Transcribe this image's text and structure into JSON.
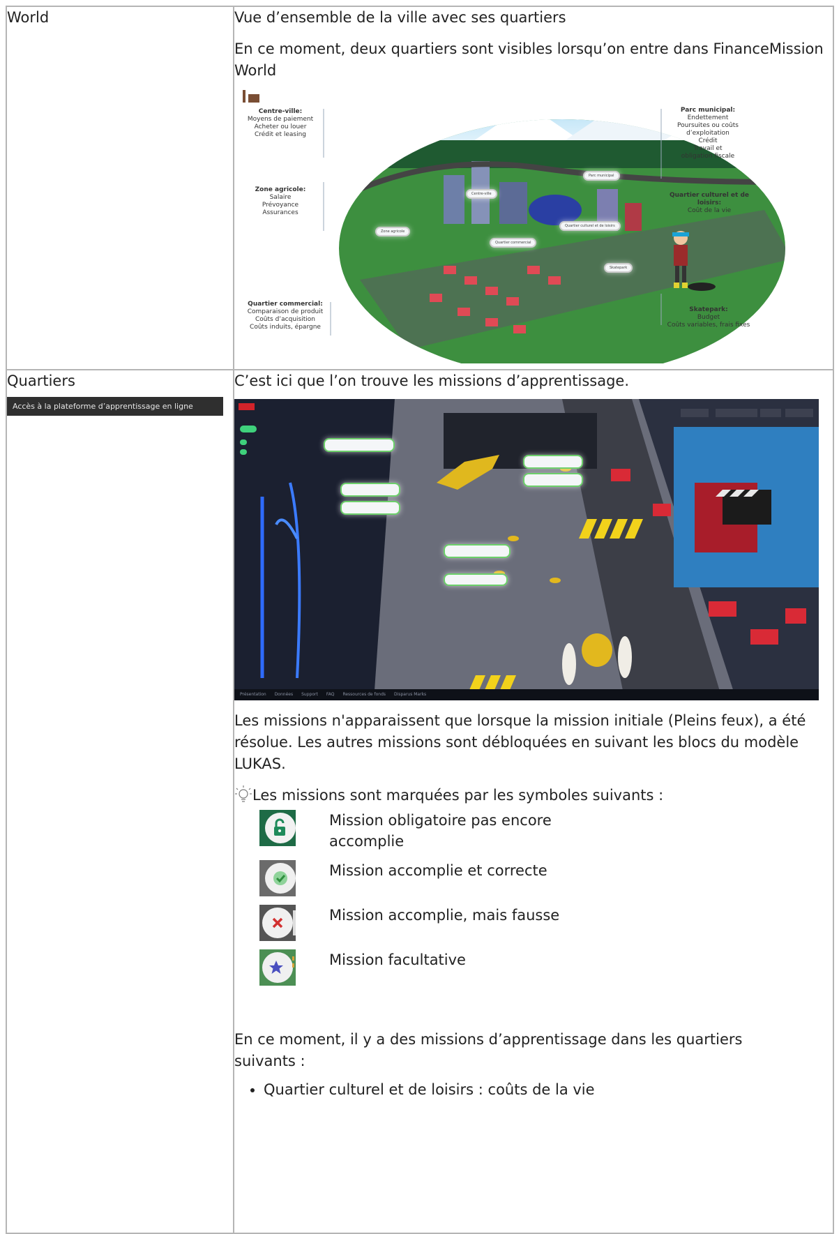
{
  "rows": [
    {
      "term": "World",
      "paragraphs": [
        "Vue d’ensemble de la ville avec ses quartiers",
        "En ce moment, deux quartiers sont visibles lorsqu’on entre dans FinanceMission World"
      ],
      "map": {
        "callouts": {
          "centre_ville": {
            "head": "Centre-ville:",
            "lines": "Moyens de paiement\nAcheter ou louer\nCrédit et leasing"
          },
          "zone_agricole": {
            "head": "Zone agricole:",
            "lines": "Salaire\nPrévoyance\nAssurances"
          },
          "quartier_commercial": {
            "head": "Quartier commercial:",
            "lines": "Comparaison de produit\nCoûts d’acquisition\nCoûts induits, épargne"
          },
          "parc_municipal": {
            "head": "Parc municipal:",
            "lines": "Endettement\nPoursuites ou coûts\nd’exploitation\nCrédit\nTravail et\nobligation fiscale"
          },
          "quartier_culturel": {
            "head": "Quartier culturel et de loisirs:",
            "lines": "Coût de la vie"
          },
          "skatepark": {
            "head": "Skatepark:",
            "lines": "Budget\nCoûts variables, frais fixes"
          }
        },
        "labels": {
          "centre_ville": "Centre-ville",
          "parc_municipal": "Parc municipal",
          "zone_agricole": "Zone agricole",
          "quartier_commercial": "Quartier commercial",
          "quartier_culturel": "Quartier culturel et de loisirs",
          "skatepark": "Skatepark"
        }
      }
    },
    {
      "term": "Quartiers",
      "badge": "Accès à la plateforme d’apprentissage en ligne",
      "intro": "C’est ici que l’on trouve les missions d’apprentissage.",
      "scene": {
        "footer": [
          "Présentation",
          "Données",
          "Support",
          "FAQ",
          "Ressources de fonds",
          "Disparus Marks"
        ]
      },
      "after_scene": "Les missions n'apparaissent que lorsque la mission initiale (Pleins feux), a été résolue. Les autres missions sont débloquées en suivant les blocs du modèle LUKAS.",
      "tip": "Les missions sont marquées par les symboles suivants :",
      "legend": [
        {
          "icon": "lock-open-icon",
          "label": "Mission obligatoire pas encore accomplie",
          "color": "#1e8a5a"
        },
        {
          "icon": "check-icon",
          "label": "Mission accomplie et correcte",
          "color": "#3aa655"
        },
        {
          "icon": "cross-icon",
          "label": "Mission accomplie, mais fausse",
          "color": "#d23030"
        },
        {
          "icon": "star-icon",
          "label": "Mission facultative",
          "color": "#4a4fbf"
        }
      ],
      "closing": "En ce moment, il y a des missions d’apprentissage dans les quartiers suivants :",
      "bullets": [
        "Quartier culturel et de loisirs : coûts de la vie"
      ]
    }
  ]
}
